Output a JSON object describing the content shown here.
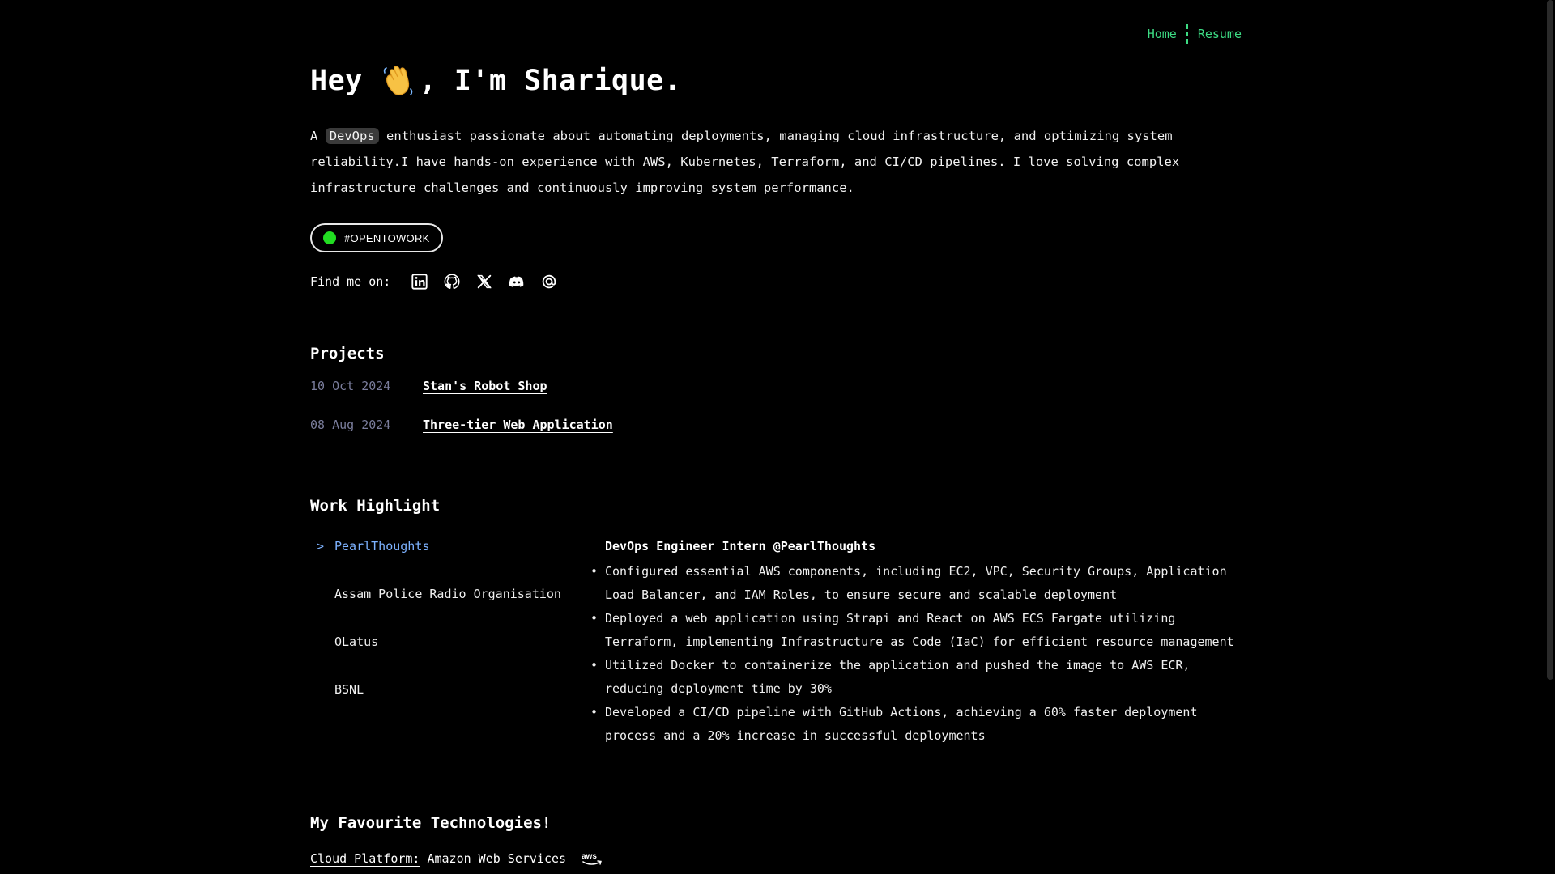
{
  "nav": {
    "home": "Home",
    "resume": "Resume"
  },
  "hero": {
    "greeting_start": "Hey",
    "greeting_end": ", I'm Sharique.",
    "intro_prefix": "A",
    "intro_chip": "DevOps",
    "intro_rest": "enthusiast passionate about automating deployments, managing cloud infrastructure, and optimizing system reliability.I have hands-on experience with AWS, Kubernetes, Terraform, and CI/CD pipelines. I love solving complex infrastructure challenges and continuously improving system performance.",
    "open_to_work": "#OPENTOWORK",
    "find_me": "Find me on:",
    "socials": [
      "linkedin-icon",
      "github-icon",
      "x-icon",
      "discord-icon",
      "at-icon"
    ]
  },
  "projects": {
    "heading": "Projects",
    "items": [
      {
        "date": "10 Oct 2024",
        "title": "Stan's Robot Shop"
      },
      {
        "date": "08 Aug 2024",
        "title": "Three-tier Web Application"
      }
    ]
  },
  "work": {
    "heading": "Work Highlight",
    "companies": [
      {
        "label": "PearlThoughts",
        "active": true
      },
      {
        "label": "Assam Police Radio Organisation",
        "active": false
      },
      {
        "label": "OLatus",
        "active": false
      },
      {
        "label": "BSNL",
        "active": false
      }
    ],
    "role": "DevOps Engineer Intern",
    "company_link": "@PearlThoughts",
    "bullets": [
      "Configured essential AWS components, including EC2, VPC, Security Groups, Application Load Balancer, and IAM Roles, to ensure secure and scalable deployment",
      "Deployed a web application using Strapi and React on AWS ECS Fargate utilizing Terraform, implementing Infrastructure as Code (IaC) for efficient resource management",
      "Utilized Docker to containerize the application and pushed the image to AWS ECR, reducing deployment time by 30%",
      "Developed a CI/CD pipeline with GitHub Actions, achieving a 60% faster deployment process and a 20% increase in successful deployments"
    ]
  },
  "tech": {
    "heading": "My Favourite Technologies!",
    "category": "Cloud Platform:",
    "value": "Amazon Web Services",
    "logo": "aws"
  },
  "colors": {
    "accent": "#3ddc84",
    "active_link": "#7db2ff",
    "date": "#7a7d9c",
    "status_dot": "#22dd22"
  }
}
